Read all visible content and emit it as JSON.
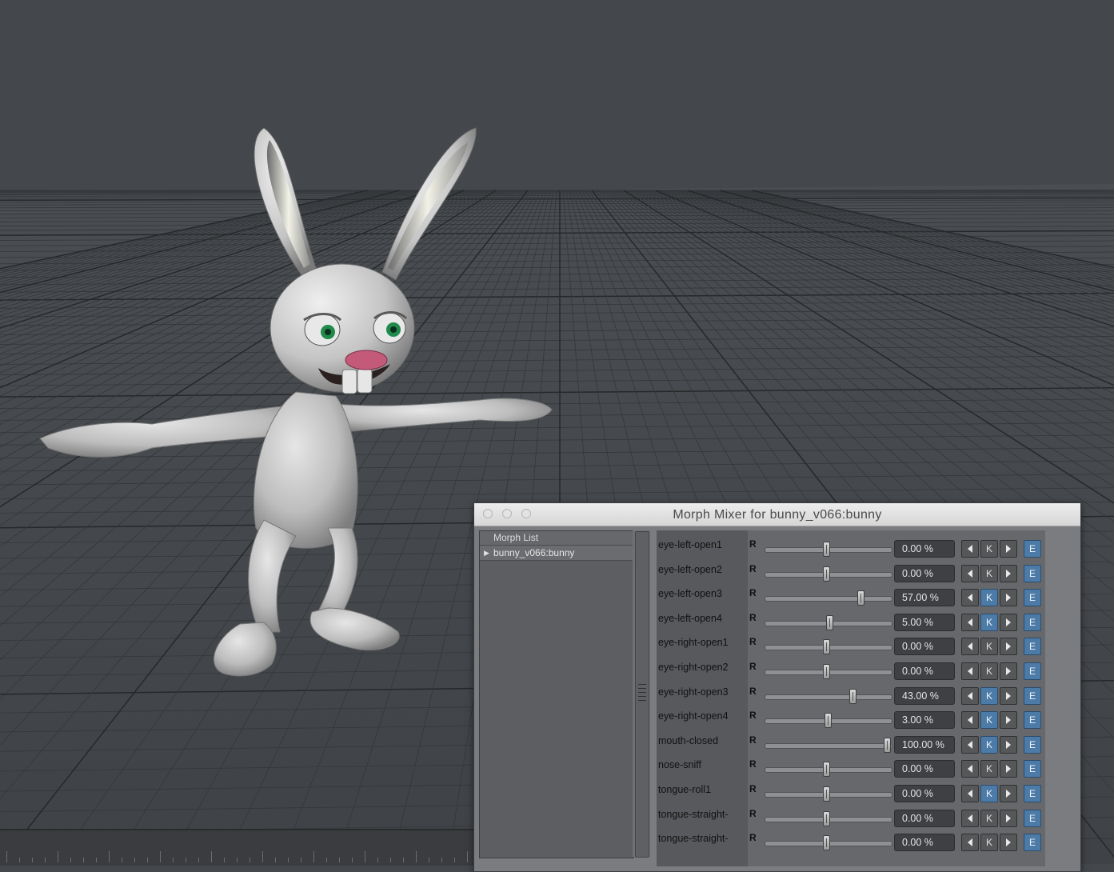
{
  "window": {
    "title": "Morph Mixer for bunny_v066:bunny"
  },
  "morph_list": {
    "header": "Morph List",
    "items": [
      "bunny_v066:bunny"
    ]
  },
  "colors": {
    "viewport_bg": "#44484c",
    "grid_line": "#2e3033",
    "bunny_body": "#c8c8c8",
    "eye_iris": "#1f8a4c",
    "nose": "#c45a7a",
    "key_button_active": "#4c7ba8"
  },
  "icons": {
    "prev_key": "triangle-left-icon",
    "next_key": "triangle-right-icon"
  },
  "morphs": [
    {
      "name": "eye-left-open1",
      "r": "R",
      "value": "0.00 %",
      "key": "K",
      "edit": "E",
      "keyed": false,
      "level": 0.5
    },
    {
      "name": "eye-left-open2",
      "r": "R",
      "value": "0.00 %",
      "key": "K",
      "edit": "E",
      "keyed": false,
      "level": 0.5
    },
    {
      "name": "eye-left-open3",
      "r": "R",
      "value": "57.00 %",
      "key": "K",
      "edit": "E",
      "keyed": true,
      "level": 0.785
    },
    {
      "name": "eye-left-open4",
      "r": "R",
      "value": "5.00 %",
      "key": "K",
      "edit": "E",
      "keyed": true,
      "level": 0.525
    },
    {
      "name": "eye-right-open1",
      "r": "R",
      "value": "0.00 %",
      "key": "K",
      "edit": "E",
      "keyed": false,
      "level": 0.5
    },
    {
      "name": "eye-right-open2",
      "r": "R",
      "value": "0.00 %",
      "key": "K",
      "edit": "E",
      "keyed": false,
      "level": 0.5
    },
    {
      "name": "eye-right-open3",
      "r": "R",
      "value": "43.00 %",
      "key": "K",
      "edit": "E",
      "keyed": true,
      "level": 0.715
    },
    {
      "name": "eye-right-open4",
      "r": "R",
      "value": "3.00 %",
      "key": "K",
      "edit": "E",
      "keyed": true,
      "level": 0.515
    },
    {
      "name": "mouth-closed",
      "r": "R",
      "value": "100.00 %",
      "key": "K",
      "edit": "E",
      "keyed": true,
      "level": 1.0
    },
    {
      "name": "nose-sniff",
      "r": "R",
      "value": "0.00 %",
      "key": "K",
      "edit": "E",
      "keyed": false,
      "level": 0.5
    },
    {
      "name": "tongue-roll1",
      "r": "R",
      "value": "0.00 %",
      "key": "K",
      "edit": "E",
      "keyed": true,
      "level": 0.5
    },
    {
      "name": "tongue-straight-",
      "r": "R",
      "value": "0.00 %",
      "key": "K",
      "edit": "E",
      "keyed": false,
      "level": 0.5
    },
    {
      "name": "tongue-straight-",
      "r": "R",
      "value": "0.00 %",
      "key": "K",
      "edit": "E",
      "keyed": false,
      "level": 0.5
    }
  ]
}
